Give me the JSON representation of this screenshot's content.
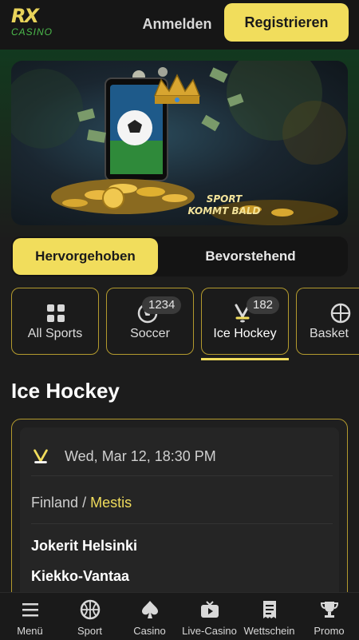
{
  "header": {
    "logo": {
      "mark": "RX",
      "word": "CASINO"
    },
    "login_label": "Anmelden",
    "register_label": "Registrieren"
  },
  "banner": {
    "line1": "SPORT",
    "line2": "KOMMT BALD"
  },
  "tabs": [
    {
      "label": "Hervorgehoben",
      "active": true
    },
    {
      "label": "Bevorstehend",
      "active": false
    }
  ],
  "sports": [
    {
      "label": "All Sports",
      "count": "",
      "icon": "grid-icon"
    },
    {
      "label": "Soccer",
      "count": "1234",
      "icon": "soccer-ball-icon"
    },
    {
      "label": "Ice Hockey",
      "count": "182",
      "icon": "ice-hockey-icon",
      "active": true
    },
    {
      "label": "Basket",
      "count": "",
      "icon": "basketball-icon"
    }
  ],
  "section_title": "Ice Hockey",
  "match": {
    "date": "Wed, Mar 12, 18:30 PM",
    "country": "Finland",
    "separator": "/",
    "league": "Mestis",
    "team_home": "Jokerit Helsinki",
    "team_away": "Kiekko-Vantaa"
  },
  "bottom_nav": [
    {
      "label": "Menü",
      "icon": "menu-icon"
    },
    {
      "label": "Sport",
      "icon": "basketball-icon"
    },
    {
      "label": "Casino",
      "icon": "spade-icon"
    },
    {
      "label": "Live-Casino",
      "icon": "tv-icon"
    },
    {
      "label": "Wettschein",
      "icon": "receipt-icon"
    },
    {
      "label": "Promo",
      "icon": "trophy-icon"
    }
  ],
  "colors": {
    "accent": "#f1dd5c",
    "background": "#1c1c1c",
    "card_border": "#b39a2e"
  }
}
